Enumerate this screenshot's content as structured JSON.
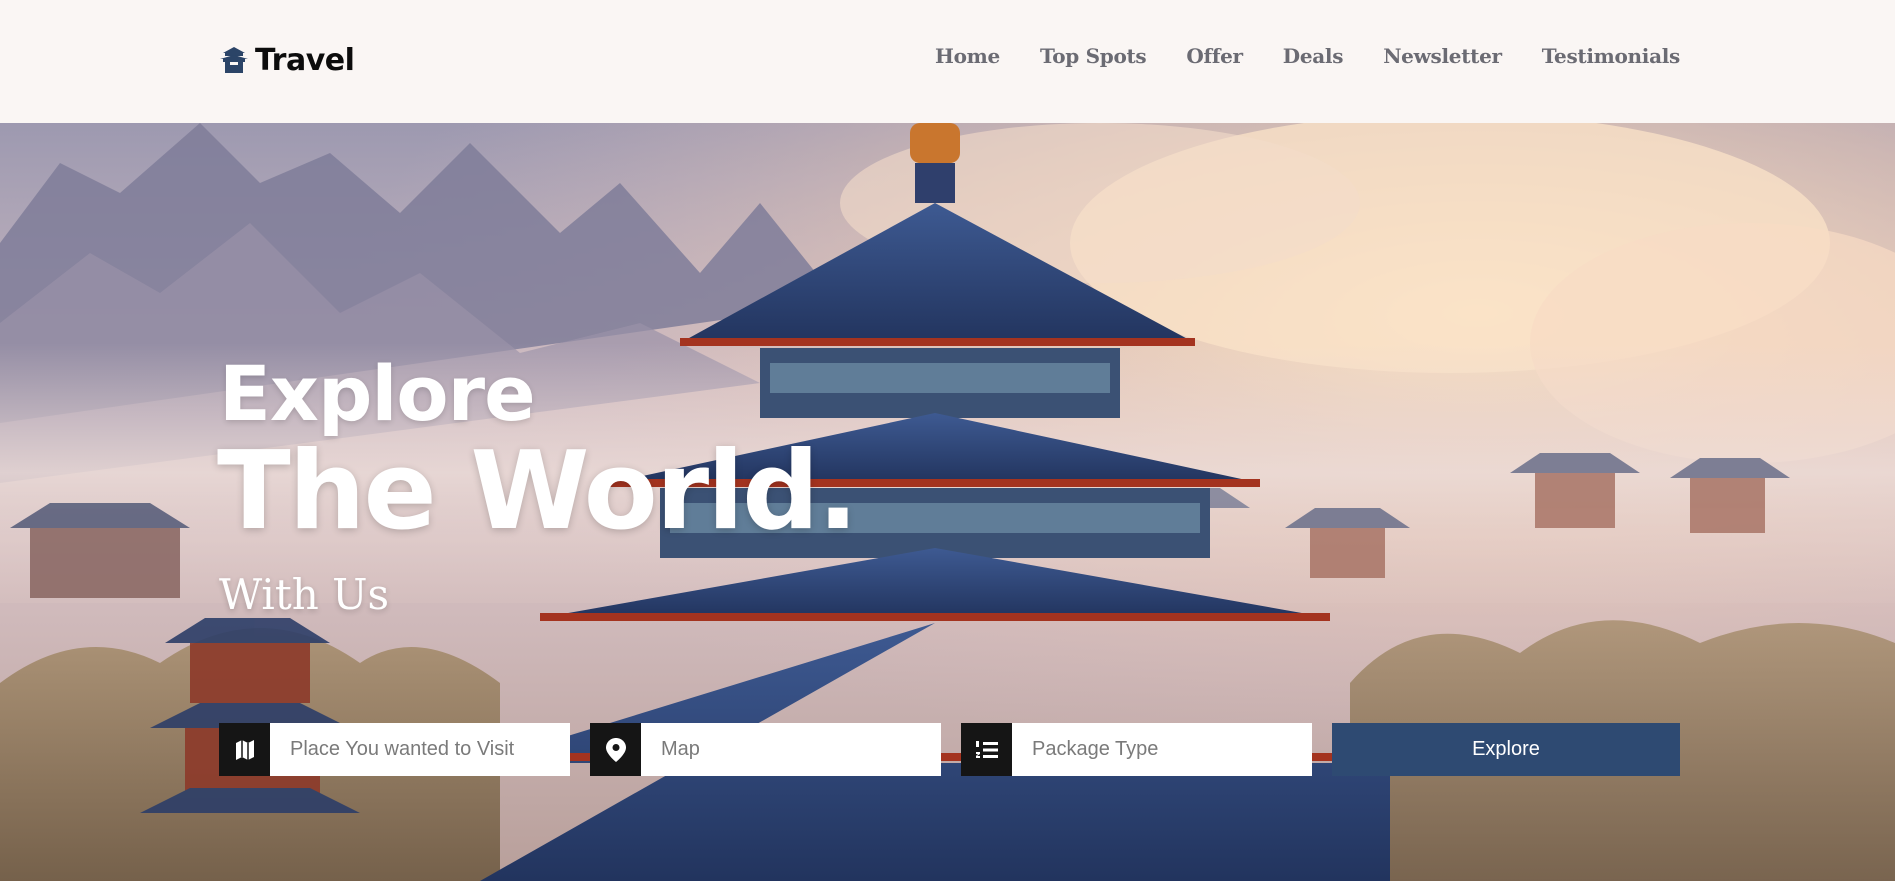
{
  "brand": {
    "name": "Travel",
    "icon": "pagoda-icon"
  },
  "nav": {
    "items": [
      {
        "label": "Home"
      },
      {
        "label": "Top Spots"
      },
      {
        "label": "Offer"
      },
      {
        "label": "Deals"
      },
      {
        "label": "Newsletter"
      },
      {
        "label": "Testimonials"
      }
    ]
  },
  "hero": {
    "line1": "Explore",
    "line2": "The World.",
    "line3": "With Us"
  },
  "search": {
    "place": {
      "placeholder": "Place You wanted to Visit",
      "icon": "map-icon"
    },
    "map": {
      "placeholder": "Map",
      "icon": "location-pin-icon"
    },
    "package": {
      "placeholder": "Package Type",
      "icon": "numbered-list-icon"
    },
    "button_label": "Explore"
  },
  "colors": {
    "button": "#2e4a72",
    "icon_bg": "#151515",
    "header_bg": "#faf6f4",
    "nav_text": "#6b6b73"
  }
}
